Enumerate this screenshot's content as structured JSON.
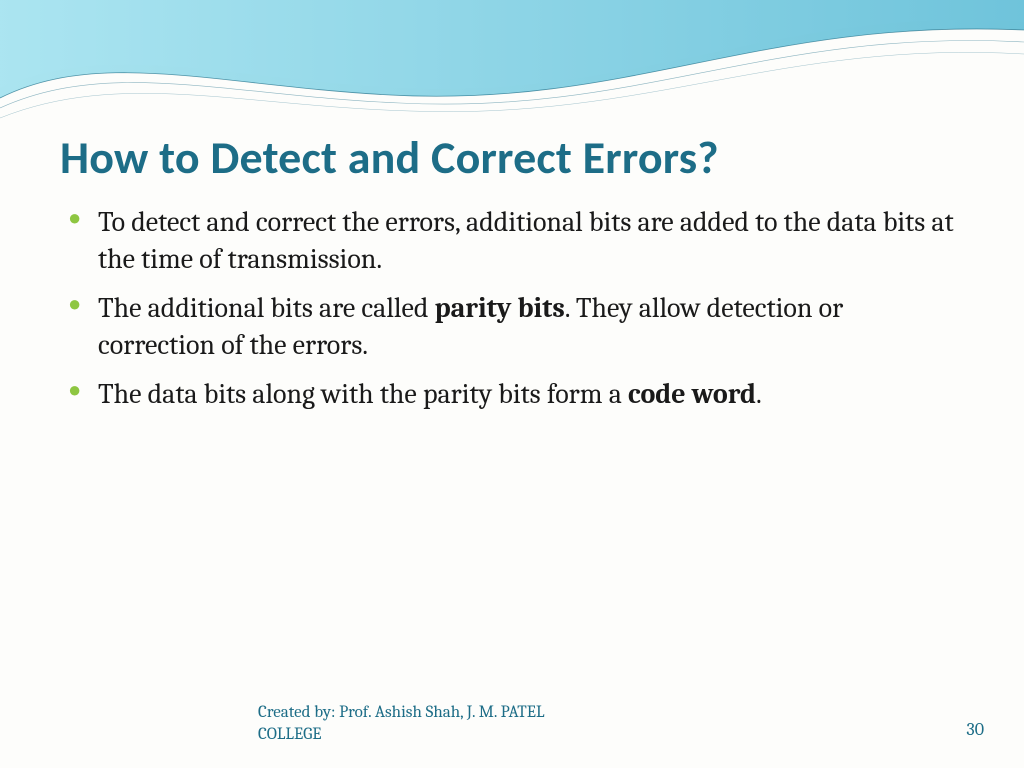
{
  "title": "How to Detect and Correct Errors?",
  "bullets": [
    {
      "pre": "To detect and correct the errors, additional bits are added to the data bits at the time of transmission.",
      "bold": "",
      "post": ""
    },
    {
      "pre": "The additional bits are called ",
      "bold": "parity bits",
      "post": ". They allow detection or correction of the errors."
    },
    {
      "pre": "The data bits along with the parity bits form a ",
      "bold": "code word",
      "post": "."
    }
  ],
  "footer": {
    "credit": "Created by: Prof. Ashish Shah, J. M. PATEL COLLEGE",
    "page": "30"
  },
  "colors": {
    "accent": "#1d6d87",
    "bullet": "#8ec641",
    "wave_light": "#a9e3f0",
    "wave_dark": "#4fb8d3"
  }
}
